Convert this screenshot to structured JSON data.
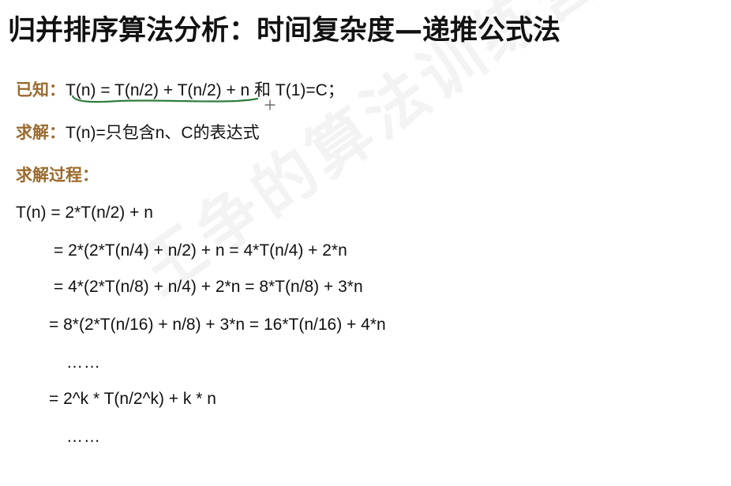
{
  "title": "归并排序算法分析：时间复杂度—递推公式法",
  "known": {
    "label": "已知：",
    "formula": "T(n) = T(n/2) + T(n/2) + n  和 T(1)=C；"
  },
  "solve": {
    "label": "求解：",
    "text": "T(n)=只包含n、C的表达式"
  },
  "process": {
    "label": "求解过程："
  },
  "derivation": [
    "T(n) = 2*T(n/2) + n",
    "= 2*(2*T(n/4) + n/2) + n = 4*T(n/4) + 2*n",
    "= 4*(2*T(n/8) + n/4) + 2*n = 8*T(n/8) + 3*n",
    "= 8*(2*T(n/16) + n/8) + 3*n = 16*T(n/16) + 4*n",
    "……",
    "= 2^k * T(n/2^k) + k * n",
    "……"
  ],
  "watermark": "王争的算法训练营",
  "colors": {
    "label": "#9b6a2d",
    "annotation": "#2f7d3c",
    "text": "#111111"
  }
}
